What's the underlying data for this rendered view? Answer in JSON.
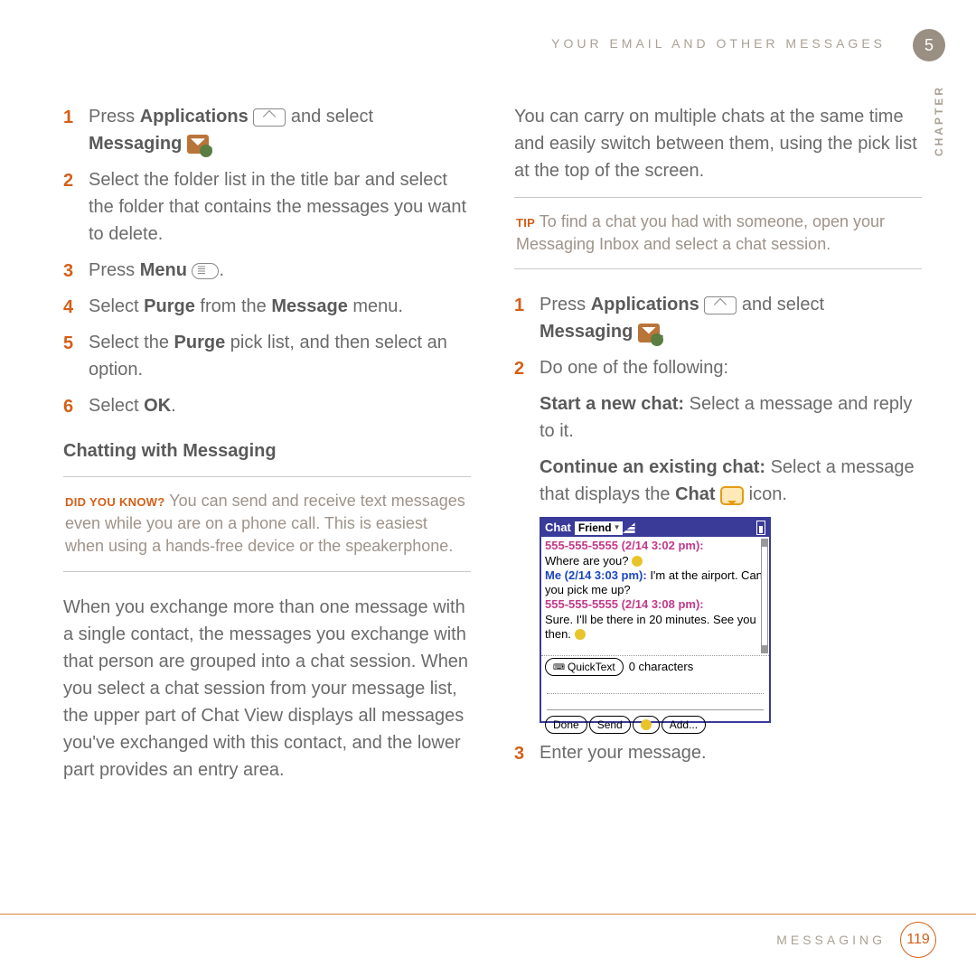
{
  "header": "YOUR EMAIL AND OTHER MESSAGES",
  "chapter_num": "5",
  "chapter_label": "CHAPTER",
  "left": {
    "step1a": "Press ",
    "step1b": "Applications",
    "step1c": " and select ",
    "step1d": "Messaging",
    "step1e": ".",
    "step2": "Select the folder list in the title bar and select the folder that contains the messages you want to delete.",
    "step3a": "Press ",
    "step3b": "Menu",
    "step3c": ".",
    "step4a": "Select ",
    "step4b": "Purge",
    "step4c": " from the ",
    "step4d": "Message",
    "step4e": " menu.",
    "step5a": "Select the ",
    "step5b": "Purge",
    "step5c": " pick list, and then select an option.",
    "step6a": "Select ",
    "step6b": "OK",
    "step6c": ".",
    "heading": "Chatting with Messaging",
    "dyk_label": "DID YOU KNOW?",
    "dyk_text": " You can send and receive text messages even while you are on a phone call. This is easiest when using a hands-free device or the speakerphone.",
    "para": "When you exchange more than one message with a single contact, the messages you exchange with that person are grouped into a chat session. When you select a chat session from your message list, the upper part of Chat View displays all messages you've exchanged with this contact, and the lower part provides an entry area."
  },
  "right": {
    "para1": "You can carry on multiple chats at the same time and easily switch between them, using the pick list at the top of the screen.",
    "tip_label": "TIP",
    "tip_text": " To find a chat you had with someone, open your Messaging Inbox and select a chat session.",
    "step1a": "Press ",
    "step1b": "Applications",
    "step1c": " and select ",
    "step1d": "Messaging",
    "step1e": ".",
    "step2": "Do one of the following:",
    "sub1a": "Start a new chat:",
    "sub1b": " Select a message and reply to it.",
    "sub2a": "Continue an existing chat:",
    "sub2b": " Select a message that displays the ",
    "sub2c": "Chat",
    "sub2d": " icon.",
    "step3": "Enter your message."
  },
  "shot": {
    "title": "Chat",
    "dd": "Friend",
    "l1": "555-555-5555 (2/14 3:02 pm):",
    "l2": "Where are you? ",
    "l3a": "Me (2/14 3:03 pm):",
    "l3b": " I'm at the airport.  Can you pick me up?",
    "l4": "555-555-5555 (2/14 3:08 pm):",
    "l5": "Sure.  I'll be there in 20 minutes.  See you then. ",
    "qt": "QuickText",
    "chars": "0 characters",
    "done": "Done",
    "send": "Send",
    "add": "Add..."
  },
  "footer": {
    "label": "MESSAGING",
    "page": "119"
  }
}
